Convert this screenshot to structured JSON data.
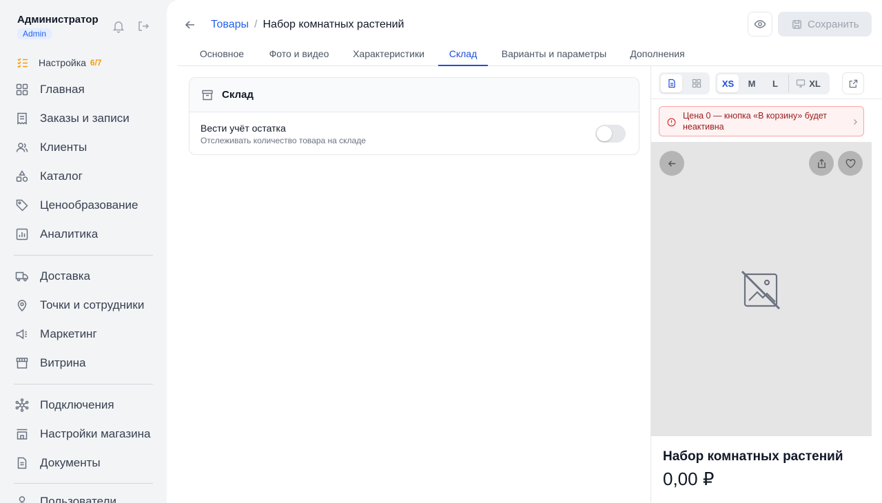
{
  "user": {
    "name": "Администратор",
    "role": "Admin"
  },
  "setup": {
    "label": "Настройка",
    "count": "6/7"
  },
  "nav": {
    "home": "Главная",
    "orders": "Заказы и записи",
    "clients": "Клиенты",
    "catalog": "Каталог",
    "pricing": "Ценообразование",
    "analytics": "Аналитика",
    "delivery": "Доставка",
    "points": "Точки и сотрудники",
    "marketing": "Маркетинг",
    "storefront": "Витрина",
    "integrations": "Подключения",
    "shop_settings": "Настройки магазина",
    "documents": "Документы",
    "users": "Пользователи"
  },
  "header": {
    "breadcrumb_parent": "Товары",
    "separator": "/",
    "breadcrumb_current": "Набор комнатных растений",
    "save_label": "Сохранить"
  },
  "tabs": {
    "main": "Основное",
    "media": "Фото и видео",
    "specs": "Характеристики",
    "stock": "Склад",
    "variants": "Варианты и параметры",
    "extras": "Дополнения",
    "active": "Склад"
  },
  "stock_card": {
    "title": "Склад",
    "track_title": "Вести учёт остатка",
    "track_sub": "Отслеживать количество товара на складе",
    "track_enabled": false
  },
  "preview": {
    "sizes": {
      "xs": "XS",
      "m": "M",
      "l": "L",
      "xl": "XL"
    },
    "active_size": "XS",
    "alert": "Цена 0 — кнопка «В корзину» будет неактивна",
    "product_title": "Набор комнатных растений",
    "price": "0,00 ₽"
  },
  "colors": {
    "accent": "#2563eb",
    "warning": "#f59e0b",
    "danger": "#dc2626"
  }
}
